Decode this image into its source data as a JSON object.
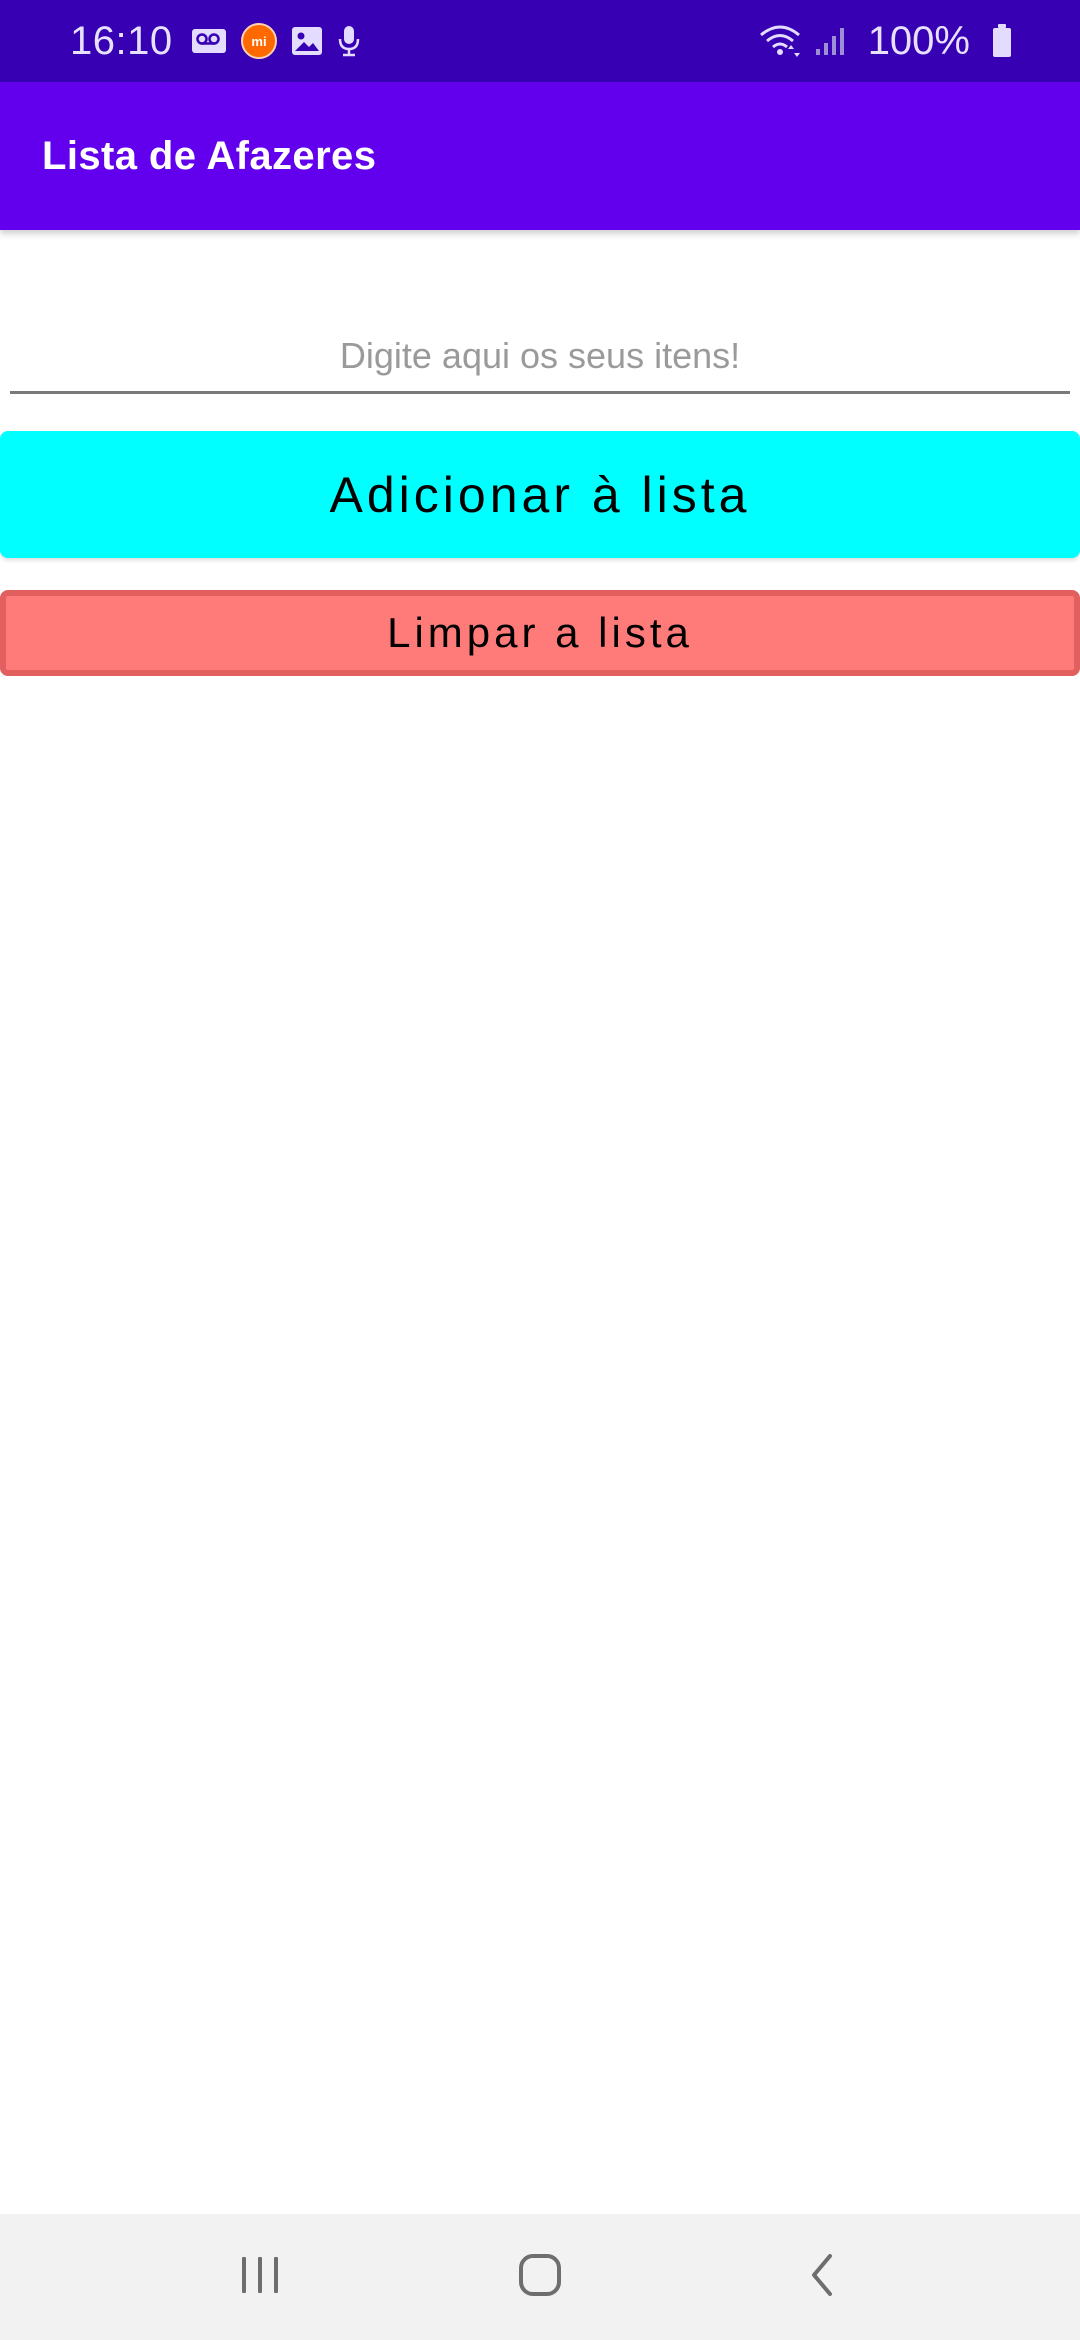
{
  "status_bar": {
    "time": "16:10",
    "battery_percent": "100%",
    "left_icons": [
      "voicemail-icon",
      "mi-app-icon",
      "image-icon",
      "microphone-icon"
    ],
    "right_icons": [
      "wifi-icon",
      "signal-icon",
      "battery-icon"
    ],
    "colors": {
      "background": "#3700b3"
    }
  },
  "app_bar": {
    "title": "Lista de Afazeres",
    "colors": {
      "background": "#6200ee"
    }
  },
  "form": {
    "item_input": {
      "value": "",
      "placeholder": "Digite aqui os seus itens!"
    },
    "add_button_label": "Adicionar à lista",
    "clear_button_label": "Limpar a lista",
    "colors": {
      "add_button": "#00ffff",
      "clear_button": "#ff7b79",
      "clear_button_border": "#e25f5f"
    }
  },
  "todo_list": {
    "items": []
  },
  "nav_bar": {
    "buttons": [
      "recents-icon",
      "home-icon",
      "back-icon"
    ]
  }
}
